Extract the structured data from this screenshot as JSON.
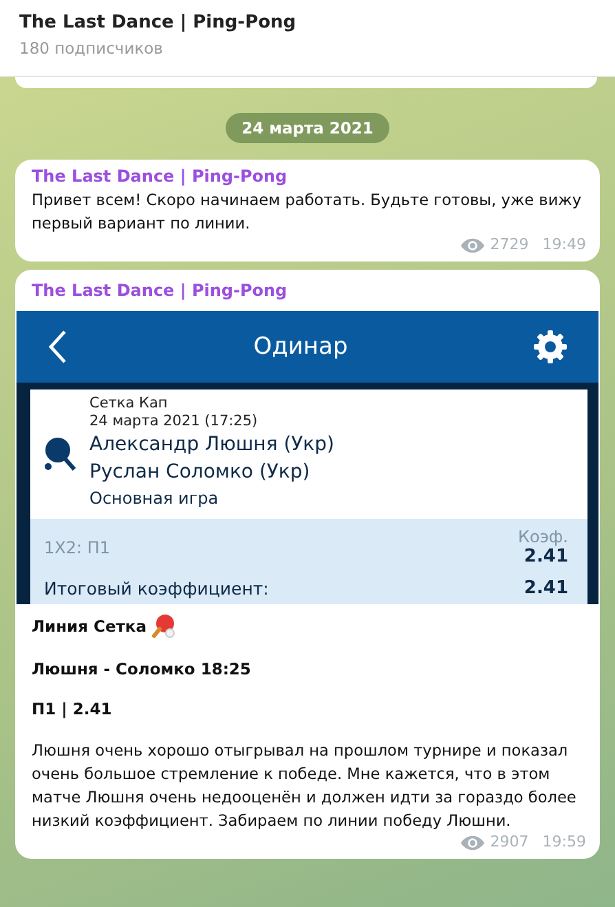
{
  "header": {
    "title": "The Last Dance | Ping-Pong",
    "subtitle": "180 подписчиков"
  },
  "date_pill": "24 марта 2021",
  "messages": [
    {
      "kind": "text",
      "author": "The Last Dance | Ping-Pong",
      "text": "Привет всем! Скоро начинаем работать. Будьте готовы, уже вижу первый вариант по линии.",
      "views": "2729",
      "time": "19:49"
    },
    {
      "kind": "photo",
      "author": "The Last Dance | Ping-Pong",
      "screenshot": {
        "title": "Одинар",
        "league": "Сетка Кап",
        "date": "24 марта 2021 (17:25)",
        "player_1": "Александр Люшня (Укр)",
        "player_2": "Руслан Соломко (Укр)",
        "market": "Основная игра",
        "bet": "1X2: П1",
        "odds_label": "Коэф.",
        "odds": "2.41",
        "total_label": "Итоговый коэффициент:",
        "total": "2.41"
      },
      "bold_lines": [
        "Линия Сетка",
        "Люшня - Соломко 18:25",
        "П1 | 2.41"
      ],
      "text": "Люшня очень хорошо отыгрывал на прошлом турнире и показал очень большое стремление к победе. Мне кажется, что в этом матче Люшня очень недооценён и должен идти за гораздо более низкий коэффициент. Забираем по линии победу Люшни.",
      "views": "2907",
      "time": "19:59"
    }
  ]
}
